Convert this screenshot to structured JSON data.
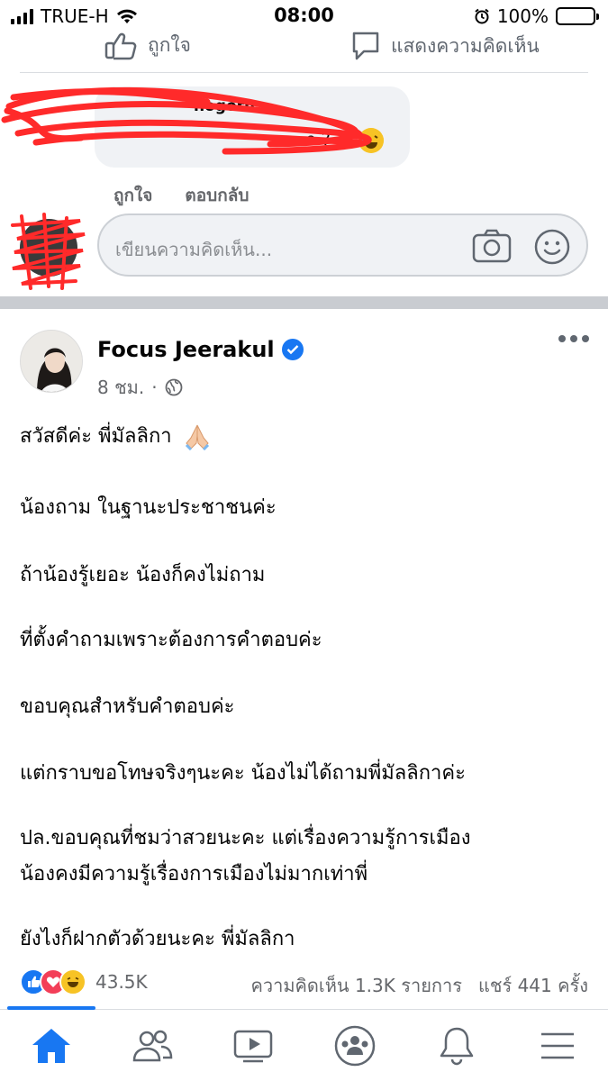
{
  "status_bar": {
    "carrier": "TRUE-H",
    "time": "08:00",
    "battery": "100%",
    "battery_level": 1.0
  },
  "previous_post": {
    "like_label": "ถูกใจ",
    "comment_label": "แสดงความคิดเห็น"
  },
  "comment": {
    "author_fragment": "hogorn",
    "text_fragment": "ว ?",
    "like_label": "ถูกใจ",
    "reply_label": "ตอบกลับ"
  },
  "comment_box": {
    "placeholder": "เขียนความคิดเห็น..."
  },
  "post": {
    "author": "Focus Jeerakul",
    "time": "8 ชม.",
    "separator": "·",
    "lines": [
      "สวัสดีค่ะ พี่มัลลิกา",
      "น้องถาม ในฐานะประชาชนค่ะ",
      "ถ้าน้องรู้เยอะ น้องก็คงไม่ถาม",
      "ที่ตั้งคำถามเพราะต้องการคำตอบค่ะ",
      "ขอบคุณสำหรับคำตอบค่ะ",
      "แต่กราบขอโทษจริงๆนะคะ น้องไม่ได้ถามพี่มัลลิกาค่ะ",
      "ปล.ขอบคุณที่ชมว่าสวยนะคะ แต่เรื่องความรู้การเมือง",
      "น้องคงมีความรู้เรื่องการเมืองไม่มากเท่าพี่",
      "ยังไงก็ฝากตัวด้วยนะคะ พี่มัลลิกา"
    ],
    "reactions_count": "43.5K",
    "comments_count": "ความคิดเห็น 1.3K รายการ",
    "shares_count": "แชร์ 441 ครั้ง"
  },
  "colors": {
    "facebook_blue": "#1877f2",
    "like_blue": "#1877f2",
    "love_red": "#f33e58",
    "haha_yellow": "#f7c325",
    "scribble_red": "#ff2a2a"
  },
  "bottom_nav": {
    "items": [
      "home-icon",
      "friends-icon",
      "watch-icon",
      "groups-icon",
      "notifications-icon",
      "menu-icon"
    ]
  }
}
